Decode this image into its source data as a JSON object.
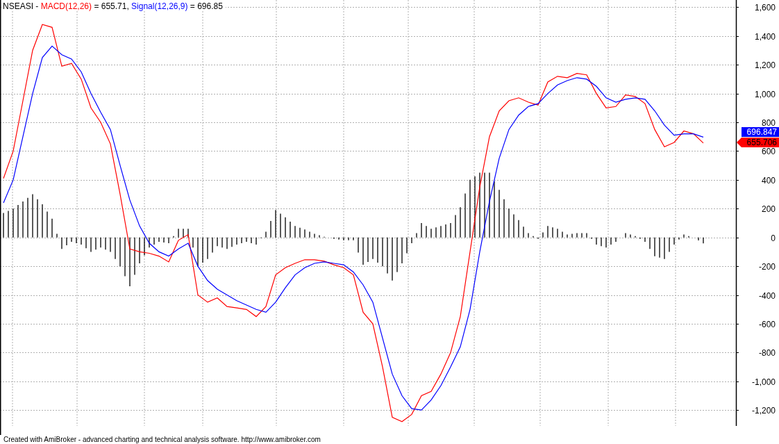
{
  "chart": {
    "title": {
      "prefix": "NSEASI - ",
      "readouts": [
        " = 655.71, ",
        " = 696.85"
      ]
    },
    "chart_data": {
      "type": "line",
      "ylim": [
        -1310,
        1650
      ],
      "grid": true,
      "yticks": [
        {
          "value": 1600,
          "label": "1,600"
        },
        {
          "value": 1400,
          "label": "1,400"
        },
        {
          "value": 1200,
          "label": "1,200"
        },
        {
          "value": 1000,
          "label": "1,000"
        },
        {
          "value": 800,
          "label": "800"
        },
        {
          "value": 600,
          "label": "600"
        },
        {
          "value": 400,
          "label": "400"
        },
        {
          "value": 200,
          "label": "200"
        },
        {
          "value": 0,
          "label": "0"
        },
        {
          "value": -200,
          "label": "-200"
        },
        {
          "value": -400,
          "label": "-400"
        },
        {
          "value": -600,
          "label": "-600"
        },
        {
          "value": -800,
          "label": "-800"
        },
        {
          "value": -1000,
          "label": "-1,000"
        },
        {
          "value": -1200,
          "label": "-1,200"
        }
      ],
      "series": [
        {
          "name": "MACD(12,26)",
          "color": "#ff0000",
          "values": [
            410,
            600,
            950,
            1300,
            1480,
            1460,
            1190,
            1210,
            1100,
            900,
            800,
            650,
            300,
            -80,
            -100,
            -110,
            -130,
            -170,
            -20,
            20,
            -400,
            -450,
            -420,
            -480,
            -490,
            -500,
            -550,
            -480,
            -260,
            -210,
            -180,
            -155,
            -155,
            -165,
            -190,
            -210,
            -260,
            -520,
            -600,
            -900,
            -1250,
            -1280,
            -1230,
            -1100,
            -1070,
            -950,
            -800,
            -550,
            -100,
            350,
            700,
            880,
            950,
            970,
            940,
            920,
            1080,
            1120,
            1110,
            1140,
            1130,
            1000,
            900,
            910,
            990,
            980,
            930,
            750,
            630,
            660,
            740,
            720,
            656
          ]
        },
        {
          "name": "Signal(12,26,9)",
          "color": "#0000ff",
          "values": [
            240,
            400,
            700,
            1000,
            1250,
            1330,
            1270,
            1240,
            1150,
            1000,
            870,
            750,
            500,
            260,
            80,
            -40,
            -100,
            -130,
            -80,
            -40,
            -200,
            -300,
            -360,
            -400,
            -440,
            -470,
            -500,
            -520,
            -450,
            -350,
            -260,
            -210,
            -180,
            -170,
            -180,
            -190,
            -240,
            -330,
            -450,
            -700,
            -950,
            -1100,
            -1190,
            -1200,
            -1130,
            -1030,
            -900,
            -760,
            -500,
            -100,
            250,
            550,
            750,
            850,
            910,
            930,
            1000,
            1060,
            1090,
            1110,
            1100,
            1050,
            970,
            940,
            960,
            970,
            960,
            880,
            780,
            710,
            720,
            720,
            697
          ]
        }
      ]
    },
    "value_badges": [
      {
        "text": "696.847",
        "color": "#0000ff",
        "kind": "box"
      },
      {
        "text": "655.706",
        "color": "#ff0000",
        "kind": "arrow"
      }
    ]
  },
  "footer": {
    "text": "Created with AmiBroker - advanced charting and technical analysis software. http://www.amibroker.com"
  }
}
